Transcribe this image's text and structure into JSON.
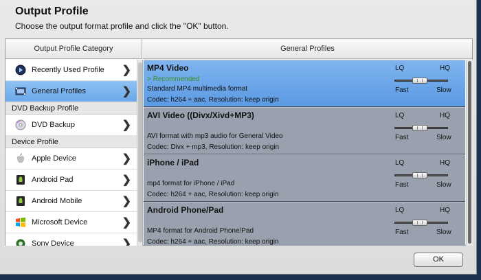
{
  "dialog": {
    "title": "Output Profile",
    "subtitle": "Choose the output format profile and click the \"OK\" button.",
    "ok_label": "OK"
  },
  "columns": {
    "left": "Output Profile Category",
    "right": "General Profiles"
  },
  "categories": [
    {
      "label": "Recently Used Profile",
      "icon": "recent-icon",
      "selected": false
    },
    {
      "label": "General Profiles",
      "icon": "general-profiles-icon",
      "selected": true
    }
  ],
  "groups": {
    "dvd": "DVD Backup Profile",
    "device": "Device Profile"
  },
  "dvd_items": [
    {
      "label": "DVD Backup",
      "icon": "dvd-icon"
    }
  ],
  "device_items": [
    {
      "label": "Apple Device",
      "icon": "apple-icon"
    },
    {
      "label": "Android Pad",
      "icon": "android-icon"
    },
    {
      "label": "Android Mobile",
      "icon": "android-icon"
    },
    {
      "label": "Microsoft Device",
      "icon": "windows-icon"
    },
    {
      "label": "Sony Device",
      "icon": "sony-icon"
    }
  ],
  "profiles": [
    {
      "name": "MP4 Video",
      "recommended": "> Recommended",
      "desc": "Standard MP4 multimedia format",
      "codec": "Codec: h264 + aac, Resolution: keep origin",
      "selected": true
    },
    {
      "name": "AVI Video ((Divx/Xivd+MP3)",
      "recommended": "",
      "desc": "AVI format with mp3 audio for  General Video",
      "codec": "Codec: Divx + mp3, Resolution: keep origin",
      "selected": false
    },
    {
      "name": "iPhone / iPad",
      "recommended": "",
      "desc": "mp4 format for iPhone / iPad",
      "codec": "Codec: h264 + aac, Resolution: keep origin",
      "selected": false
    },
    {
      "name": "Android Phone/Pad",
      "recommended": "",
      "desc": "MP4 format for Android Phone/Pad",
      "codec": "Codec: h264 + aac, Resolution: keep origin",
      "selected": false
    }
  ],
  "quality": {
    "lq": "LQ",
    "hq": "HQ",
    "fast": "Fast",
    "slow": "Slow"
  }
}
